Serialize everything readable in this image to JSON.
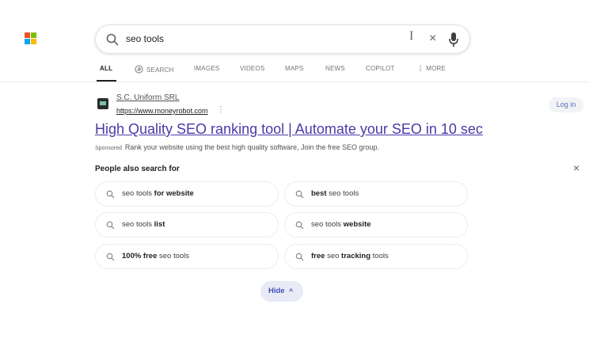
{
  "brand": {
    "colors": [
      "#f35325",
      "#81bc06",
      "#05a6f0",
      "#ffba08"
    ]
  },
  "search": {
    "query": "seo tools",
    "caret": "I",
    "clear": "×"
  },
  "tabs": [
    {
      "label": "ALL",
      "active": true
    },
    {
      "label": "SEARCH",
      "icon": "copilot-icon"
    },
    {
      "label": "IMAGES"
    },
    {
      "label": "VIDEOS"
    },
    {
      "label": "MAPS"
    },
    {
      "label": "NEWS"
    },
    {
      "label": "COPILOT"
    },
    {
      "label": "MORE",
      "icon": "kebab-icon"
    }
  ],
  "ad": {
    "company": "S.C. Uniform SRL",
    "url": "https://www.moneyrobot.com",
    "more": "⋮",
    "title": "High Quality SEO ranking tool | Automate your SEO in 10 sec",
    "sponsored": "Sponsored",
    "description": "Rank your website using the best high quality software, Join the free SEO group."
  },
  "header": {
    "login": "Log in"
  },
  "pasf": {
    "title": "People also search for",
    "close": "×",
    "items": [
      {
        "plain1": "seo tools ",
        "bold1": "for website",
        "plain2": "",
        "bold2": "",
        "plain3": ""
      },
      {
        "plain1": "",
        "bold1": "best",
        "plain2": " seo tools",
        "bold2": "",
        "plain3": ""
      },
      {
        "plain1": "seo tools ",
        "bold1": "list",
        "plain2": "",
        "bold2": "",
        "plain3": ""
      },
      {
        "plain1": "seo tools ",
        "bold1": "website",
        "plain2": "",
        "bold2": "",
        "plain3": ""
      },
      {
        "plain1": "",
        "bold1": "100% free",
        "plain2": " seo tools",
        "bold2": "",
        "plain3": ""
      },
      {
        "plain1": "",
        "bold1": "free",
        "plain2": " seo ",
        "bold2": "tracking",
        "plain3": " tools"
      }
    ],
    "hide": "Hide",
    "hide_chevron": "^"
  }
}
